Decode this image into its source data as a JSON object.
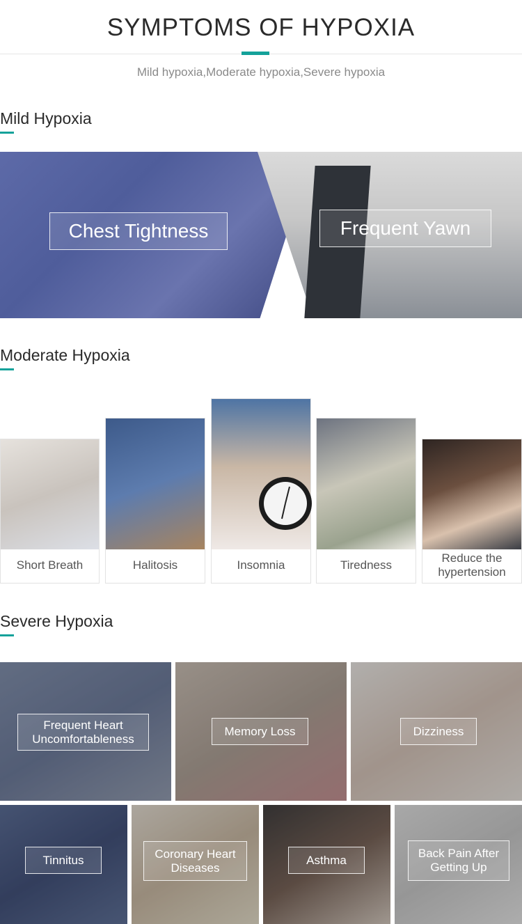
{
  "header": {
    "title": "SYMPTOMS OF HYPOXIA",
    "subtitle": "Mild hypoxia,Moderate hypoxia,Severe hypoxia"
  },
  "mild": {
    "heading": "Mild Hypoxia",
    "labels": [
      "Chest Tightness",
      "Frequent Yawn"
    ]
  },
  "moderate": {
    "heading": "Moderate Hypoxia",
    "cards": [
      "Short Breath",
      "Halitosis",
      "Insomnia",
      "Tiredness",
      "Reduce the hypertension"
    ]
  },
  "severe": {
    "heading": "Severe Hypoxia",
    "row1": [
      "Frequent Heart Uncomfortableness",
      "Memory Loss",
      "Dizziness"
    ],
    "row2": [
      "Tinnitus",
      "Coronary Heart Diseases",
      "Asthma",
      "Back Pain After Getting Up"
    ]
  },
  "colors": {
    "accent": "#14a29a"
  }
}
